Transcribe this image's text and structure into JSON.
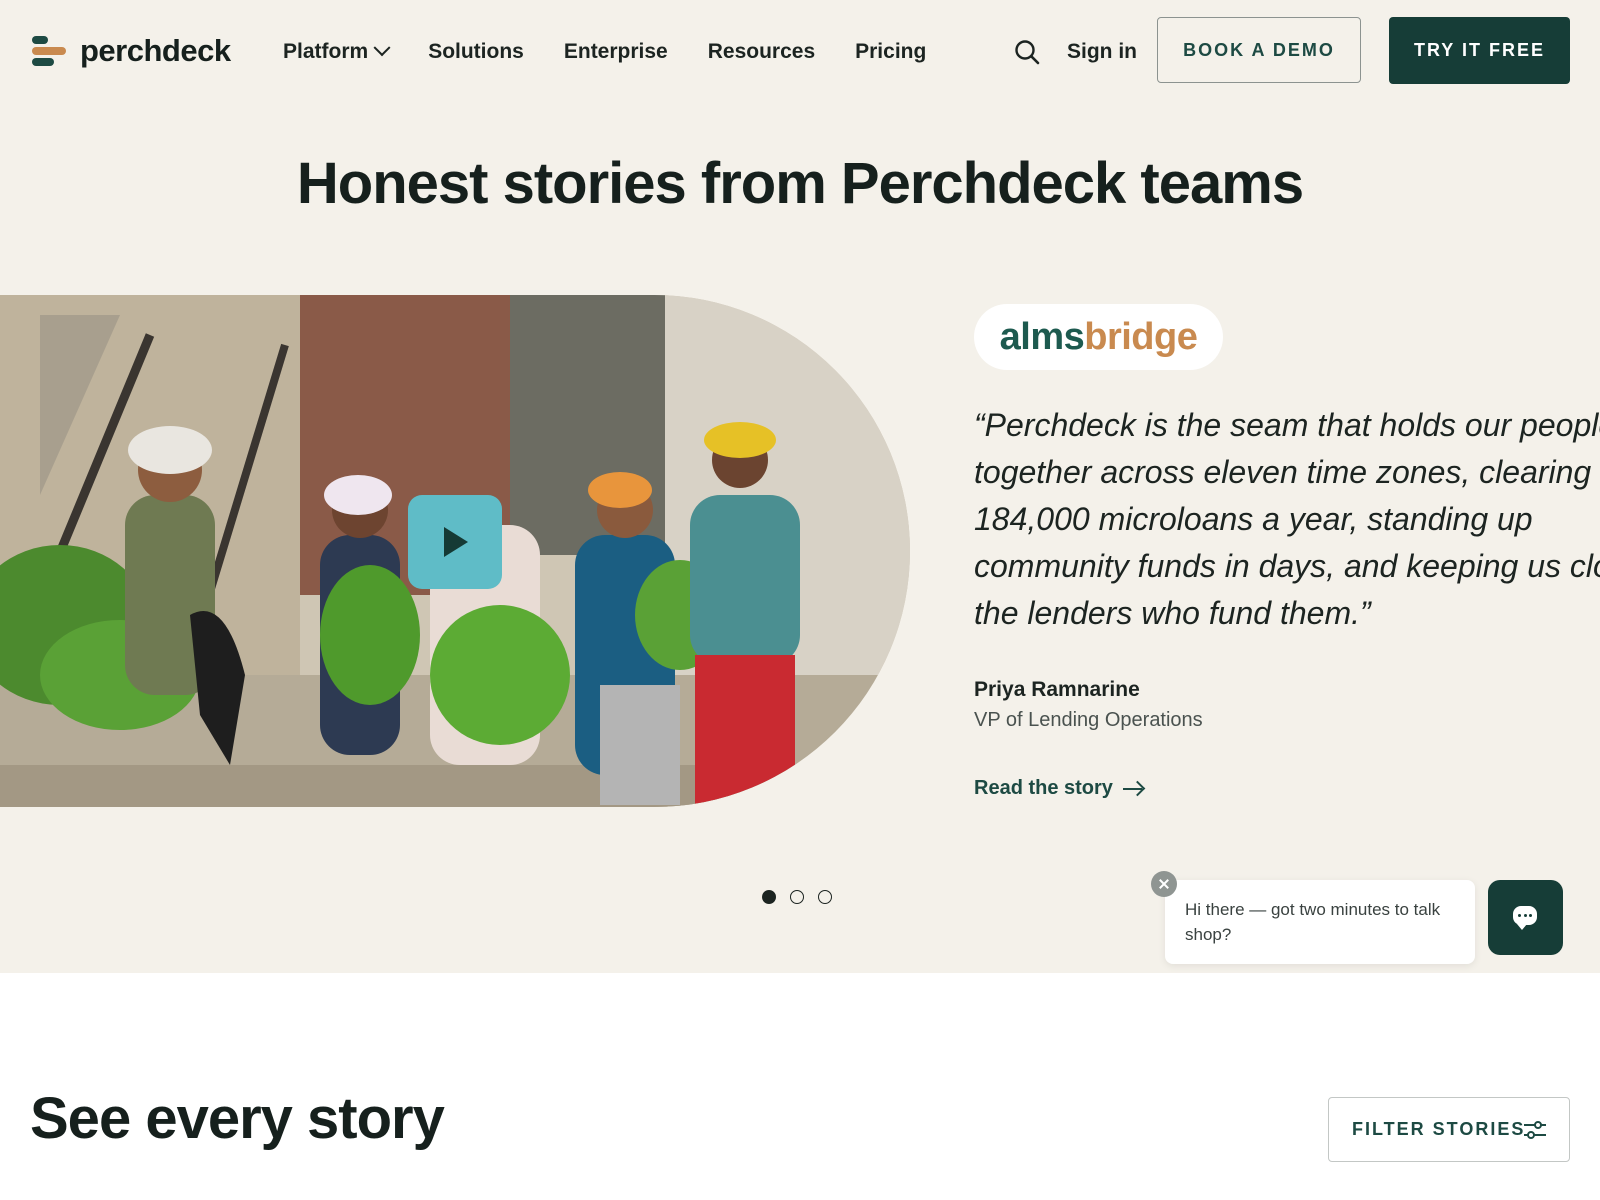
{
  "brand": {
    "name": "perchdeck",
    "colors": {
      "primary": "#163d37",
      "accent": "#c98a4f",
      "play": "#5fbcc7",
      "background": "#f4f1ea"
    }
  },
  "nav": {
    "items": [
      {
        "label": "Platform",
        "has_dropdown": true
      },
      {
        "label": "Solutions"
      },
      {
        "label": "Enterprise"
      },
      {
        "label": "Resources"
      },
      {
        "label": "Pricing"
      }
    ],
    "search_icon": "search-icon",
    "sign_in": "Sign in",
    "book_demo": "BOOK A DEMO",
    "try_free": "TRY IT FREE"
  },
  "hero": {
    "headline": "Honest stories from Perchdeck teams",
    "featured": {
      "company_a": "alms",
      "company_b": "bridge",
      "quote_lines": [
        "“Perchdeck is the seam that holds our people",
        "together across eleven time zones, clearing",
        "184,000 microloans a year, standing up",
        "community funds in days, and keeping us close to",
        "the lenders who fund them.”"
      ],
      "person_name": "Priya Ramnarine",
      "person_role": "VP of Lending Operations",
      "link_label": "Read the story"
    },
    "carousel": {
      "count": 3,
      "active": 1
    }
  },
  "chat": {
    "message": "Hi there — got two minutes to talk shop?"
  },
  "stories": {
    "title": "See every story",
    "filter_label": "FILTER STORIES"
  }
}
